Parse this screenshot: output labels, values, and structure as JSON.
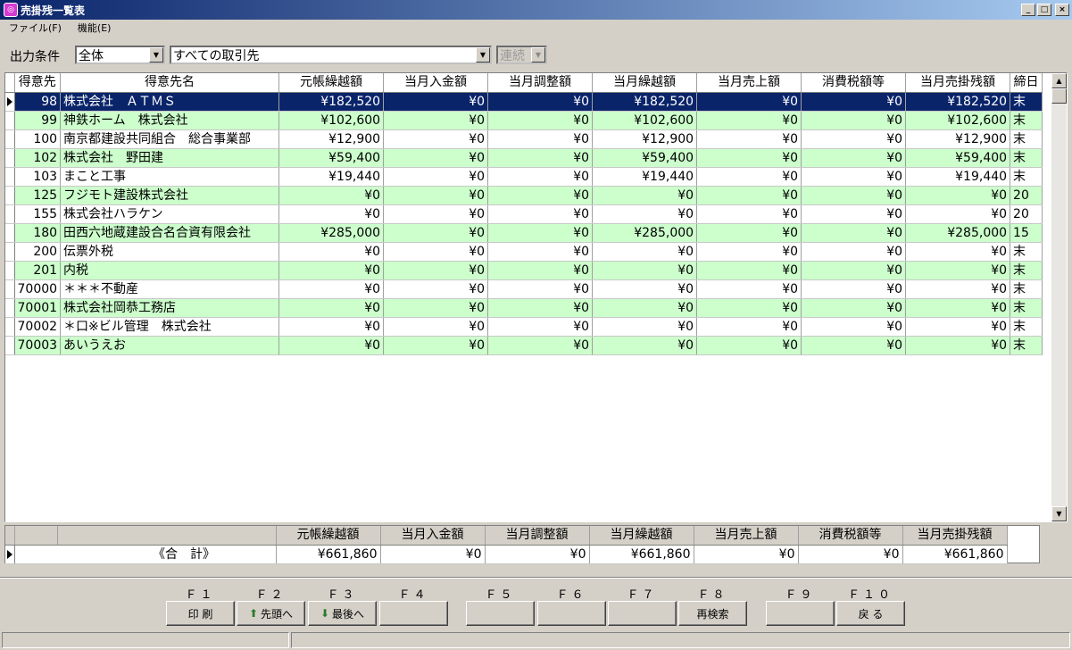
{
  "window": {
    "title": "売掛残一覧表",
    "controls": [
      "_",
      "□",
      "×"
    ]
  },
  "menu": [
    {
      "label": "ファイル(F)"
    },
    {
      "label": "機能(E)"
    }
  ],
  "conditions": {
    "label": "出力条件",
    "scope": "全体",
    "client_filter": "すべての取引先",
    "mode": "連続"
  },
  "grid": {
    "columns": [
      "得意先",
      "得意先名",
      "元帳繰越額",
      "当月入金額",
      "当月調整額",
      "当月繰越額",
      "当月売上額",
      "消費税額等",
      "当月売掛残額",
      "締日"
    ],
    "rows": [
      {
        "code": "98",
        "name": "株式会社　ＡＴＭＳ",
        "carry": "¥182,520",
        "paid": "¥0",
        "adj": "¥0",
        "fwd": "¥182,520",
        "sales": "¥0",
        "tax": "¥0",
        "bal": "¥182,520",
        "close": "末"
      },
      {
        "code": "99",
        "name": "神鉄ホーム　株式会社",
        "carry": "¥102,600",
        "paid": "¥0",
        "adj": "¥0",
        "fwd": "¥102,600",
        "sales": "¥0",
        "tax": "¥0",
        "bal": "¥102,600",
        "close": "末"
      },
      {
        "code": "100",
        "name": "南京都建設共同組合　総合事業部",
        "carry": "¥12,900",
        "paid": "¥0",
        "adj": "¥0",
        "fwd": "¥12,900",
        "sales": "¥0",
        "tax": "¥0",
        "bal": "¥12,900",
        "close": "末"
      },
      {
        "code": "102",
        "name": "株式会社　野田建",
        "carry": "¥59,400",
        "paid": "¥0",
        "adj": "¥0",
        "fwd": "¥59,400",
        "sales": "¥0",
        "tax": "¥0",
        "bal": "¥59,400",
        "close": "末"
      },
      {
        "code": "103",
        "name": "まこと工事",
        "carry": "¥19,440",
        "paid": "¥0",
        "adj": "¥0",
        "fwd": "¥19,440",
        "sales": "¥0",
        "tax": "¥0",
        "bal": "¥19,440",
        "close": "末"
      },
      {
        "code": "125",
        "name": "フジモト建設株式会社",
        "carry": "¥0",
        "paid": "¥0",
        "adj": "¥0",
        "fwd": "¥0",
        "sales": "¥0",
        "tax": "¥0",
        "bal": "¥0",
        "close": "20"
      },
      {
        "code": "155",
        "name": "株式会社ハラケン",
        "carry": "¥0",
        "paid": "¥0",
        "adj": "¥0",
        "fwd": "¥0",
        "sales": "¥0",
        "tax": "¥0",
        "bal": "¥0",
        "close": "20"
      },
      {
        "code": "180",
        "name": "田西六地蔵建設合名合資有限会社",
        "carry": "¥285,000",
        "paid": "¥0",
        "adj": "¥0",
        "fwd": "¥285,000",
        "sales": "¥0",
        "tax": "¥0",
        "bal": "¥285,000",
        "close": "15"
      },
      {
        "code": "200",
        "name": "伝票外税",
        "carry": "¥0",
        "paid": "¥0",
        "adj": "¥0",
        "fwd": "¥0",
        "sales": "¥0",
        "tax": "¥0",
        "bal": "¥0",
        "close": "末"
      },
      {
        "code": "201",
        "name": "内税",
        "carry": "¥0",
        "paid": "¥0",
        "adj": "¥0",
        "fwd": "¥0",
        "sales": "¥0",
        "tax": "¥0",
        "bal": "¥0",
        "close": "末"
      },
      {
        "code": "70000",
        "name": "＊＊＊不動産",
        "carry": "¥0",
        "paid": "¥0",
        "adj": "¥0",
        "fwd": "¥0",
        "sales": "¥0",
        "tax": "¥0",
        "bal": "¥0",
        "close": "末"
      },
      {
        "code": "70001",
        "name": "株式会社岡恭工務店",
        "carry": "¥0",
        "paid": "¥0",
        "adj": "¥0",
        "fwd": "¥0",
        "sales": "¥0",
        "tax": "¥0",
        "bal": "¥0",
        "close": "末"
      },
      {
        "code": "70002",
        "name": "＊口※ビル管理　株式会社",
        "carry": "¥0",
        "paid": "¥0",
        "adj": "¥0",
        "fwd": "¥0",
        "sales": "¥0",
        "tax": "¥0",
        "bal": "¥0",
        "close": "末"
      },
      {
        "code": "70003",
        "name": "あいうえお",
        "carry": "¥0",
        "paid": "¥0",
        "adj": "¥0",
        "fwd": "¥0",
        "sales": "¥0",
        "tax": "¥0",
        "bal": "¥0",
        "close": "末"
      }
    ],
    "selected_index": 0,
    "colors": {
      "selected": "#0a246a",
      "alternate": "#ccffcc"
    }
  },
  "summary": {
    "columns": [
      "元帳繰越額",
      "当月入金額",
      "当月調整額",
      "当月繰越額",
      "当月売上額",
      "消費税額等",
      "当月売掛残額"
    ],
    "label": "《合　計》",
    "values": [
      "¥661,860",
      "¥0",
      "¥0",
      "¥661,860",
      "¥0",
      "¥0",
      "¥661,860"
    ]
  },
  "function_keys": [
    {
      "key": "Ｆ１",
      "label": "印 刷",
      "icon": ""
    },
    {
      "key": "Ｆ２",
      "label": "先頭へ",
      "icon": "up-arrow-icon"
    },
    {
      "key": "Ｆ３",
      "label": "最後へ",
      "icon": "down-arrow-icon"
    },
    {
      "key": "Ｆ４",
      "label": "",
      "icon": ""
    },
    {
      "key": "Ｆ５",
      "label": "",
      "icon": ""
    },
    {
      "key": "Ｆ６",
      "label": "",
      "icon": ""
    },
    {
      "key": "Ｆ７",
      "label": "",
      "icon": ""
    },
    {
      "key": "Ｆ８",
      "label": "再検索",
      "icon": ""
    },
    {
      "key": "Ｆ９",
      "label": "",
      "icon": ""
    },
    {
      "key": "Ｆ１０",
      "label": "戻 る",
      "icon": ""
    }
  ]
}
